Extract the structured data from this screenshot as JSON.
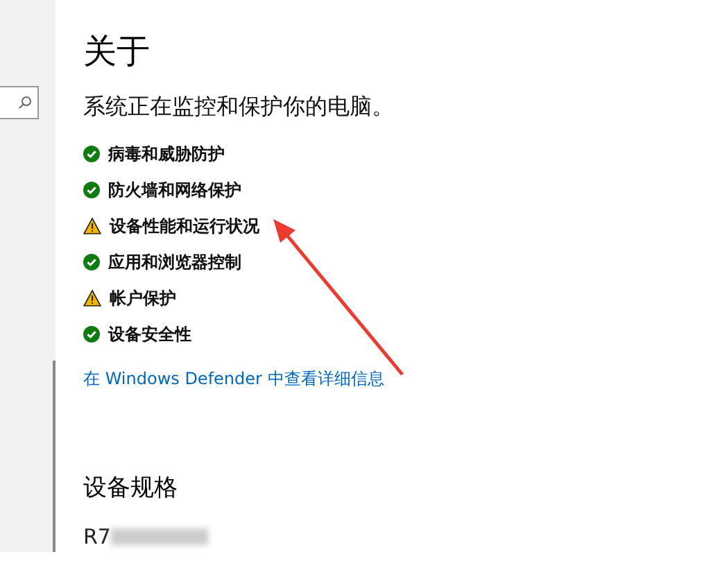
{
  "page": {
    "title": "关于",
    "subtitle": "系统正在监控和保护你的电脑。"
  },
  "protection_items": [
    {
      "label": "病毒和威胁防护",
      "kind": "ok"
    },
    {
      "label": "防火墙和网络保护",
      "kind": "ok"
    },
    {
      "label": "设备性能和运行状况",
      "kind": "warning"
    },
    {
      "label": "应用和浏览器控制",
      "kind": "ok"
    },
    {
      "label": "帐户保护",
      "kind": "warning"
    },
    {
      "label": "设备安全性",
      "kind": "ok"
    }
  ],
  "details_link": "在 Windows Defender 中查看详细信息",
  "device_specs": {
    "heading": "设备规格",
    "device_name_partial": "R7"
  }
}
